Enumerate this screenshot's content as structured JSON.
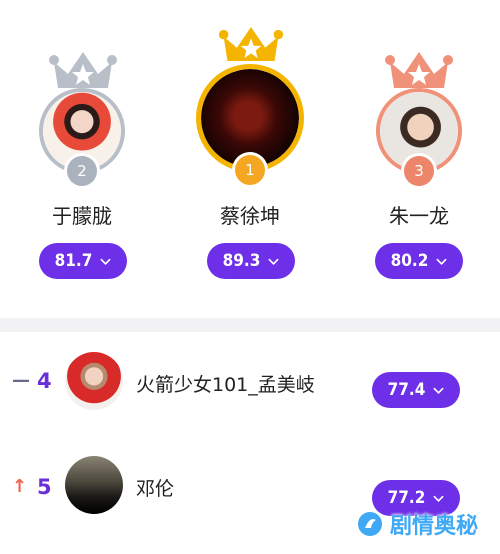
{
  "top3": [
    {
      "rank": "2",
      "name": "于朦胧",
      "score": "81.7",
      "crown_color": "#b8bfc8",
      "ring_color": "#b8bfc8",
      "medal_color": "#a9b2bd",
      "photo": "person-portrait"
    },
    {
      "rank": "1",
      "name": "蔡徐坤",
      "score": "89.3",
      "crown_color": "#f5b400",
      "ring_color": "#f5b400",
      "medal_color": "#f5a623",
      "photo": "person-portrait"
    },
    {
      "rank": "3",
      "name": "朱一龙",
      "score": "80.2",
      "crown_color": "#f0917a",
      "ring_color": "#f0917a",
      "medal_color": "#ec8569",
      "photo": "person-portrait"
    }
  ],
  "list": [
    {
      "trend": "—",
      "trend_type": "same",
      "trend_color": "#6a6a8a",
      "rank": "4",
      "name": "火箭少女101_孟美岐",
      "score": "77.4"
    },
    {
      "trend": "↑",
      "trend_type": "up",
      "trend_color": "#f0604a",
      "rank": "5",
      "name": "邓伦",
      "score": "77.2"
    }
  ],
  "watermark": {
    "text": "剧情奥秘",
    "icon": "logo-icon"
  },
  "colors": {
    "accent": "#6e2fe8",
    "rank_text": "#6a2fd6"
  }
}
